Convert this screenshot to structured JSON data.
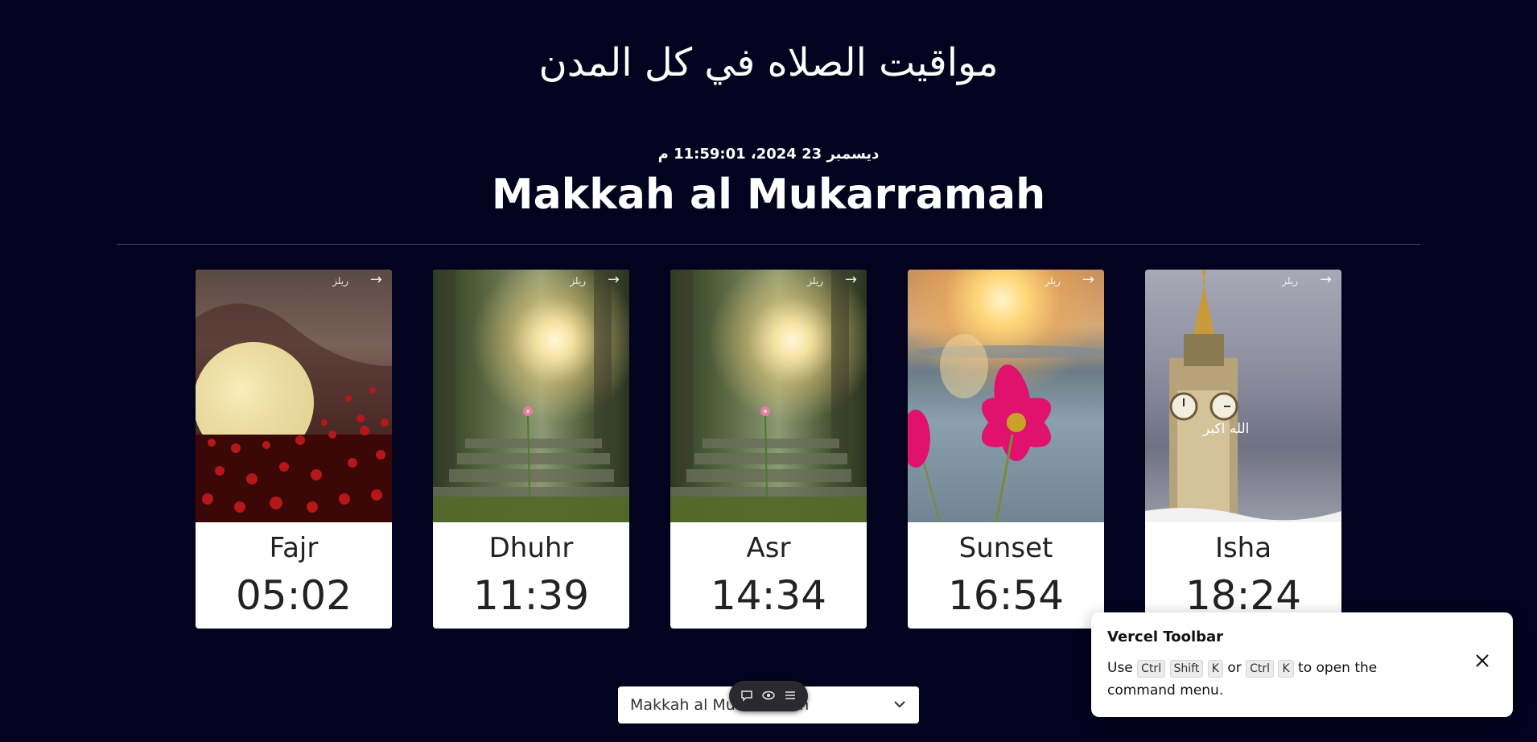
{
  "header": {
    "title": "مواقيت الصلاه في كل المدن",
    "datetime": "ديسمبر 23 2024، 11:59:01 م",
    "city": "Makkah al Mukarramah"
  },
  "cards": [
    {
      "name": "Fajr",
      "time": "05:02",
      "watermark": "ريلز",
      "arrow": "→",
      "scene": "fajr"
    },
    {
      "name": "Dhuhr",
      "time": "11:39",
      "watermark": "ريلز",
      "arrow": "→",
      "scene": "dhuhr"
    },
    {
      "name": "Asr",
      "time": "14:34",
      "watermark": "ريلز",
      "arrow": "→",
      "scene": "asr"
    },
    {
      "name": "Sunset",
      "time": "16:54",
      "watermark": "ريلز",
      "arrow": "→",
      "scene": "sunset"
    },
    {
      "name": "Isha",
      "time": "18:24",
      "watermark": "ريلز",
      "arrow": "→",
      "scene": "isha",
      "overlay_text": "الله اكبر"
    }
  ],
  "city_select": {
    "value": "Makkah al Mukarramah",
    "chevron_icon": "chevron-down-icon"
  },
  "tool_pill": {
    "icons": [
      "comment-icon",
      "eye-icon",
      "menu-icon"
    ]
  },
  "toast": {
    "title": "Vercel Toolbar",
    "use": "Use",
    "key1": "Ctrl",
    "key2": "Shift",
    "key3": "K",
    "or": "or",
    "key4": "Ctrl",
    "key5": "K",
    "suffix": "to open the command menu.",
    "close_icon": "close-icon"
  },
  "colors": {
    "background": "#03031f",
    "card": "#ffffff",
    "text_dark": "#222222"
  }
}
